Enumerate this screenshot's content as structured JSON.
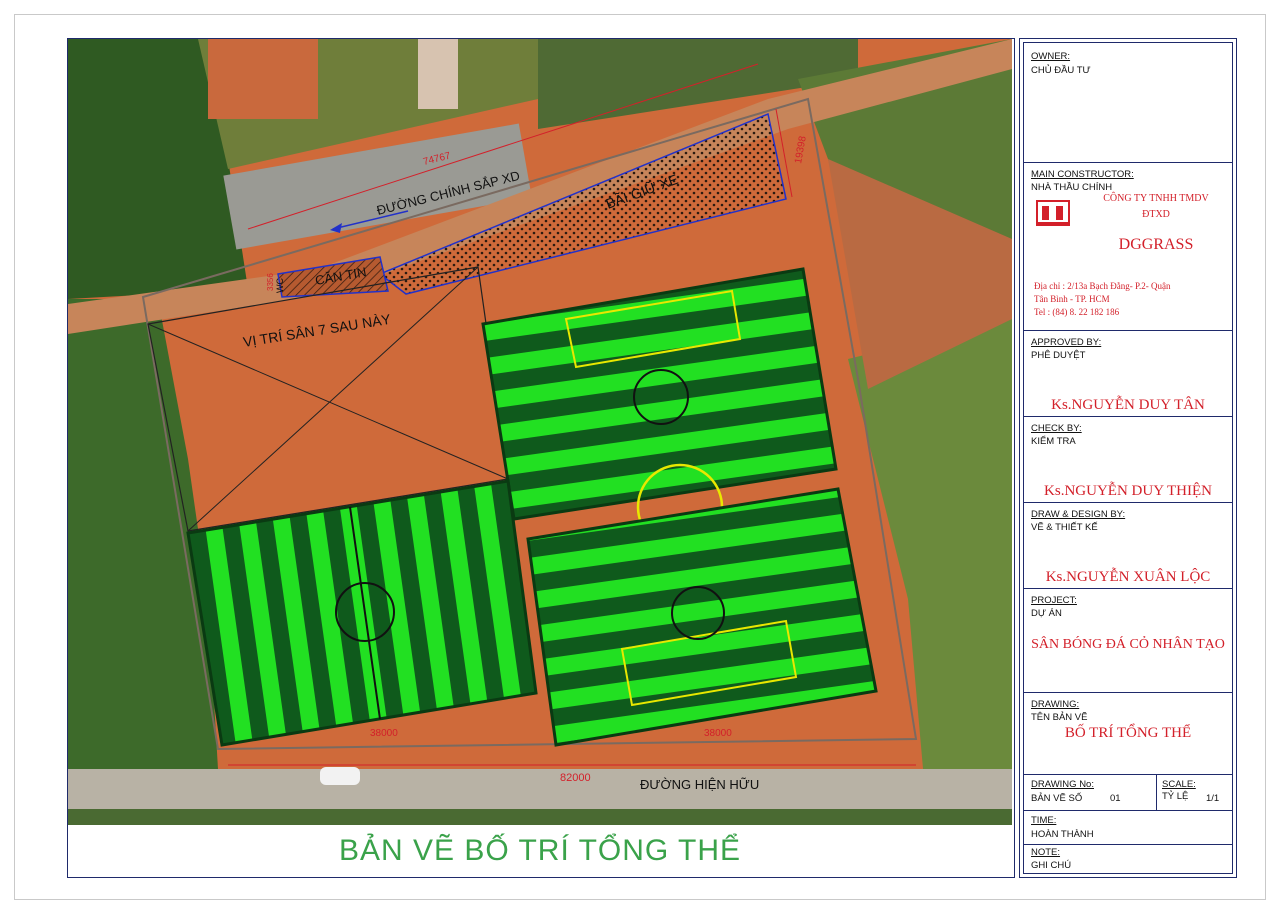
{
  "drawing": {
    "street_top": "ĐƯỜNG CHÍNH SẮP XD",
    "street_bottom": "ĐƯỜNG HIỆN HỮU",
    "parking": "BÃI GIỮ XE",
    "canteen": "CĂN TIN",
    "wc": "WC",
    "future_field": "VỊ TRÍ SÂN 7 SAU NÀY",
    "dim_top": "74767",
    "dim_right": "19398",
    "dim_bottom_total": "82000",
    "dim_field_left": "38000",
    "dim_field_right": "38000",
    "dim_small": "3356",
    "caption": "BẢN VẼ BỐ TRÍ TỔNG THỂ"
  },
  "title_block": {
    "owner_label": "OWNER:",
    "owner_value": "CHỦ ĐẦU TƯ",
    "contractor_label": "MAIN CONSTRUCTOR:",
    "contractor_value": "NHÀ THẦU CHÍNH",
    "company_line1": "CÔNG TY TNHH TMDV",
    "company_line2": "ĐTXD",
    "company_brand": "DGGRASS",
    "address_line1": "Địa chỉ  : 2/13a Bạch Đằng- P.2- Quận",
    "address_line2": "Tân Bình - TP. HCM",
    "address_line3": "Tel       : (84) 8. 22 182 186",
    "approved_label": "APPROVED BY:",
    "approved_sub": "PHÊ DUYỆT",
    "approved_name": "Ks.NGUYỄN DUY TÂN",
    "check_label": "CHECK BY:",
    "check_sub": "KIỂM TRA",
    "check_name": "Ks.NGUYỄN DUY THIỆN",
    "draw_label": "DRAW & DESIGN BY:",
    "draw_sub": "VẼ & THIẾT KẾ",
    "draw_name": "Ks.NGUYỄN XUÂN LỘC",
    "project_label": "PROJECT:",
    "project_sub": "DỰ ÁN",
    "project_name": "SÂN BÓNG ĐÁ CỎ NHÂN TẠO",
    "drawing_label": "DRAWING:",
    "drawing_sub": "TÊN BẢN VẼ",
    "drawing_name": "BỐ TRÍ TỔNG THỂ",
    "drawing_no_label": "DRAWING No:",
    "drawing_no_sub": "BẢN VẼ SỐ",
    "drawing_no_value": "01",
    "scale_label": "SCALE:",
    "scale_sub": "TỶ LỆ",
    "scale_value": "1/1",
    "time_label": "TIME:",
    "time_value": "HOÀN THÀNH",
    "note_label": "NOTE:",
    "note_value": "GHI CHÚ"
  },
  "colors": {
    "frame": "#1f2a6b",
    "red_text": "#d3202a",
    "caption_green": "#3aa24a",
    "turf_light": "#22e022",
    "turf_dark": "#0f5a1c",
    "soil": "#cf6a3a"
  }
}
